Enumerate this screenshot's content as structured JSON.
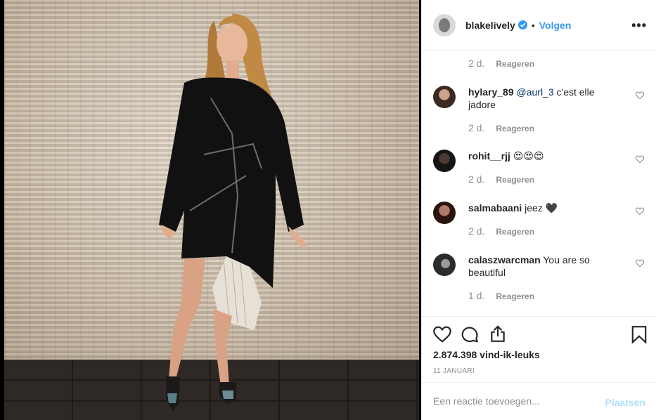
{
  "post": {
    "image_alt": "",
    "author": {
      "username": "blakelively",
      "separator": "•",
      "follow_label": "Volgen",
      "more_label": "•••"
    }
  },
  "top_meta": {
    "time": "2 d.",
    "reply_label": "Reageren"
  },
  "comments": [
    {
      "username": "hylary_89",
      "mention": "@aurl_3",
      "text": " c'est elle jadore",
      "time": "2 d.",
      "reply_label": "Reageren"
    },
    {
      "username": "rohit__rjj",
      "mention": "",
      "text": " 😍😍😍",
      "time": "2 d.",
      "reply_label": "Reageren"
    },
    {
      "username": "salmabaani",
      "mention": "",
      "text": " jeez 🖤",
      "time": "2 d.",
      "reply_label": "Reageren"
    },
    {
      "username": "calaszwarcman",
      "mention": "",
      "text": " You are so beautiful",
      "time": "1 d.",
      "reply_label": "Reageren"
    }
  ],
  "actions": {
    "likes": "2.874.398 vind-ik-leuks",
    "date": "11 JANUARI"
  },
  "add_comment": {
    "placeholder": "Een reactie toevoegen...",
    "post_label": "Plaatsen"
  },
  "colors": {
    "accent": "#3897f0",
    "text": "#262626",
    "muted": "#8e8e8e",
    "post_disabled": "#b2dffc"
  }
}
